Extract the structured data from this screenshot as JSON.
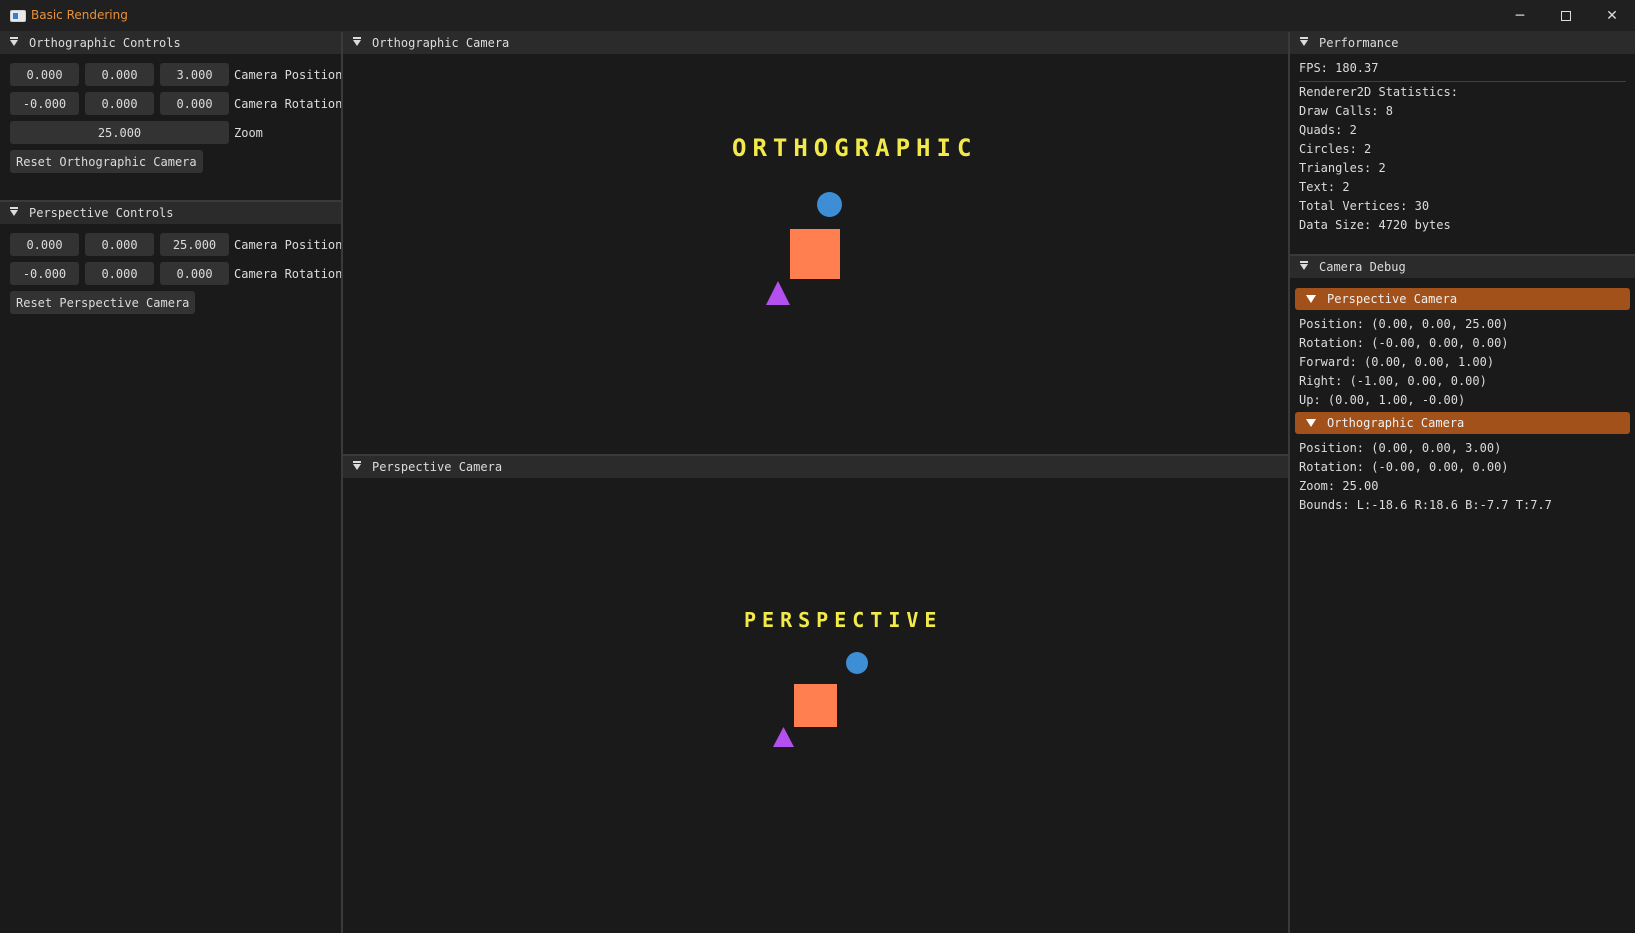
{
  "window": {
    "title": "Basic Rendering",
    "minimize_glyph": "─",
    "close_glyph": "✕"
  },
  "ortho_controls": {
    "header": "Orthographic Controls",
    "position": [
      "0.000",
      "0.000",
      "3.000"
    ],
    "position_label": "Camera Position",
    "rotation": [
      "-0.000",
      "0.000",
      "0.000"
    ],
    "rotation_label": "Camera Rotation",
    "zoom": "25.000",
    "zoom_label": "Zoom",
    "reset_label": "Reset Orthographic Camera"
  },
  "persp_controls": {
    "header": "Perspective Controls",
    "position": [
      "0.000",
      "0.000",
      "25.000"
    ],
    "position_label": "Camera Position",
    "rotation": [
      "-0.000",
      "0.000",
      "0.000"
    ],
    "rotation_label": "Camera Rotation",
    "reset_label": "Reset Perspective Camera"
  },
  "ortho_view": {
    "header": "Orthographic Camera",
    "scene_text": "ORTHOGRAPHIC"
  },
  "persp_view": {
    "header": "Perspective Camera",
    "scene_text": "PERSPECTIVE"
  },
  "scene_colors": {
    "text": "#f2ea4a",
    "circle": "#3d8ed4",
    "quad": "#ff7f50",
    "triangle": "#b44ff0"
  },
  "performance": {
    "header": "Performance",
    "fps": "FPS: 180.37",
    "stats_title": "Renderer2D Statistics:",
    "draw_calls": "Draw Calls: 8",
    "quads": "Quads: 2",
    "circles": "Circles: 2",
    "triangles": "Triangles: 2",
    "text": "Text: 2",
    "total_vertices": "Total Vertices: 30",
    "data_size": "Data Size: 4720 bytes"
  },
  "camera_debug": {
    "header": "Camera Debug",
    "perspective": {
      "title": "Perspective Camera",
      "position": "Position: (0.00, 0.00, 25.00)",
      "rotation": "Rotation: (-0.00, 0.00, 0.00)",
      "forward": "Forward: (0.00, 0.00, 1.00)",
      "right": "Right: (-1.00, 0.00, 0.00)",
      "up": "Up: (0.00, 1.00, -0.00)"
    },
    "orthographic": {
      "title": "Orthographic Camera",
      "position": "Position: (0.00, 0.00, 3.00)",
      "rotation": "Rotation: (-0.00, 0.00, 0.00)",
      "zoom": "Zoom: 25.00",
      "bounds": "Bounds: L:-18.6 R:18.6 B:-7.7 T:7.7"
    }
  },
  "accent_color": "#a3511a"
}
